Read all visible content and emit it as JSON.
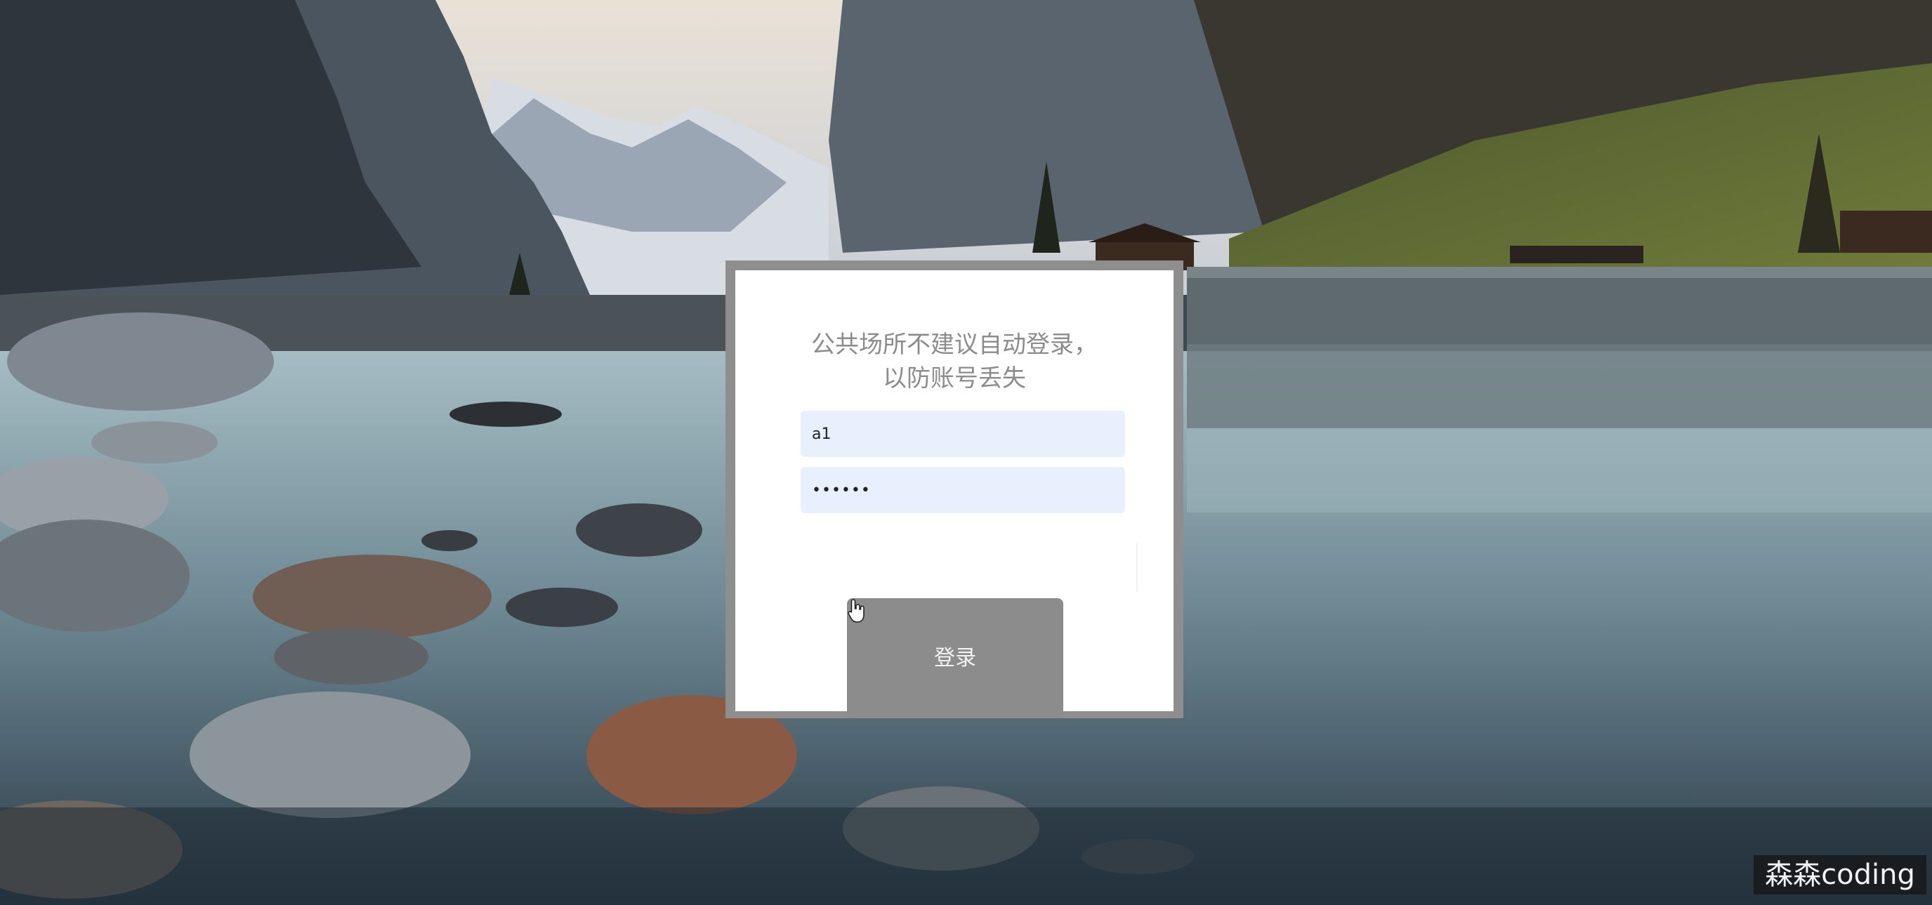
{
  "login": {
    "notice_line1": "公共场所不建议自动登录，",
    "notice_line2": "以防账号丢失",
    "username_value": "a1",
    "password_value": "••••••",
    "submit_label": "登录"
  },
  "watermark": {
    "text": "森森coding"
  },
  "colors": {
    "card_border": "#8e8e8e",
    "input_background": "#e8f0fe",
    "button_background": "#8c8c8c",
    "notice_text": "#8c8c8c"
  },
  "icons": {
    "cursor": "hand-pointer-icon"
  }
}
